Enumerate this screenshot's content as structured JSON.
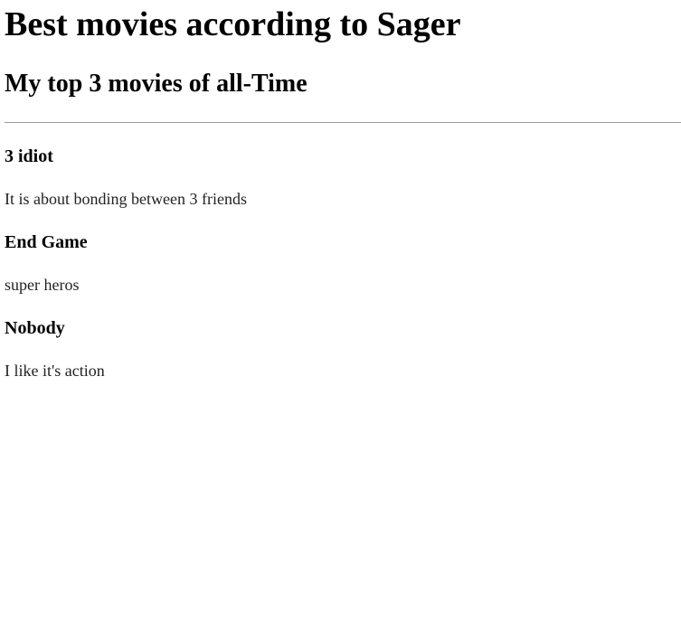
{
  "page": {
    "heading": "Best movies according to Sager",
    "subheading": "My top 3 movies of all-Time"
  },
  "movies": [
    {
      "title": "3 idiot",
      "description": "It is about bonding between 3 friends"
    },
    {
      "title": "End Game",
      "description": "super heros"
    },
    {
      "title": "Nobody",
      "description": "I like it's action"
    }
  ]
}
